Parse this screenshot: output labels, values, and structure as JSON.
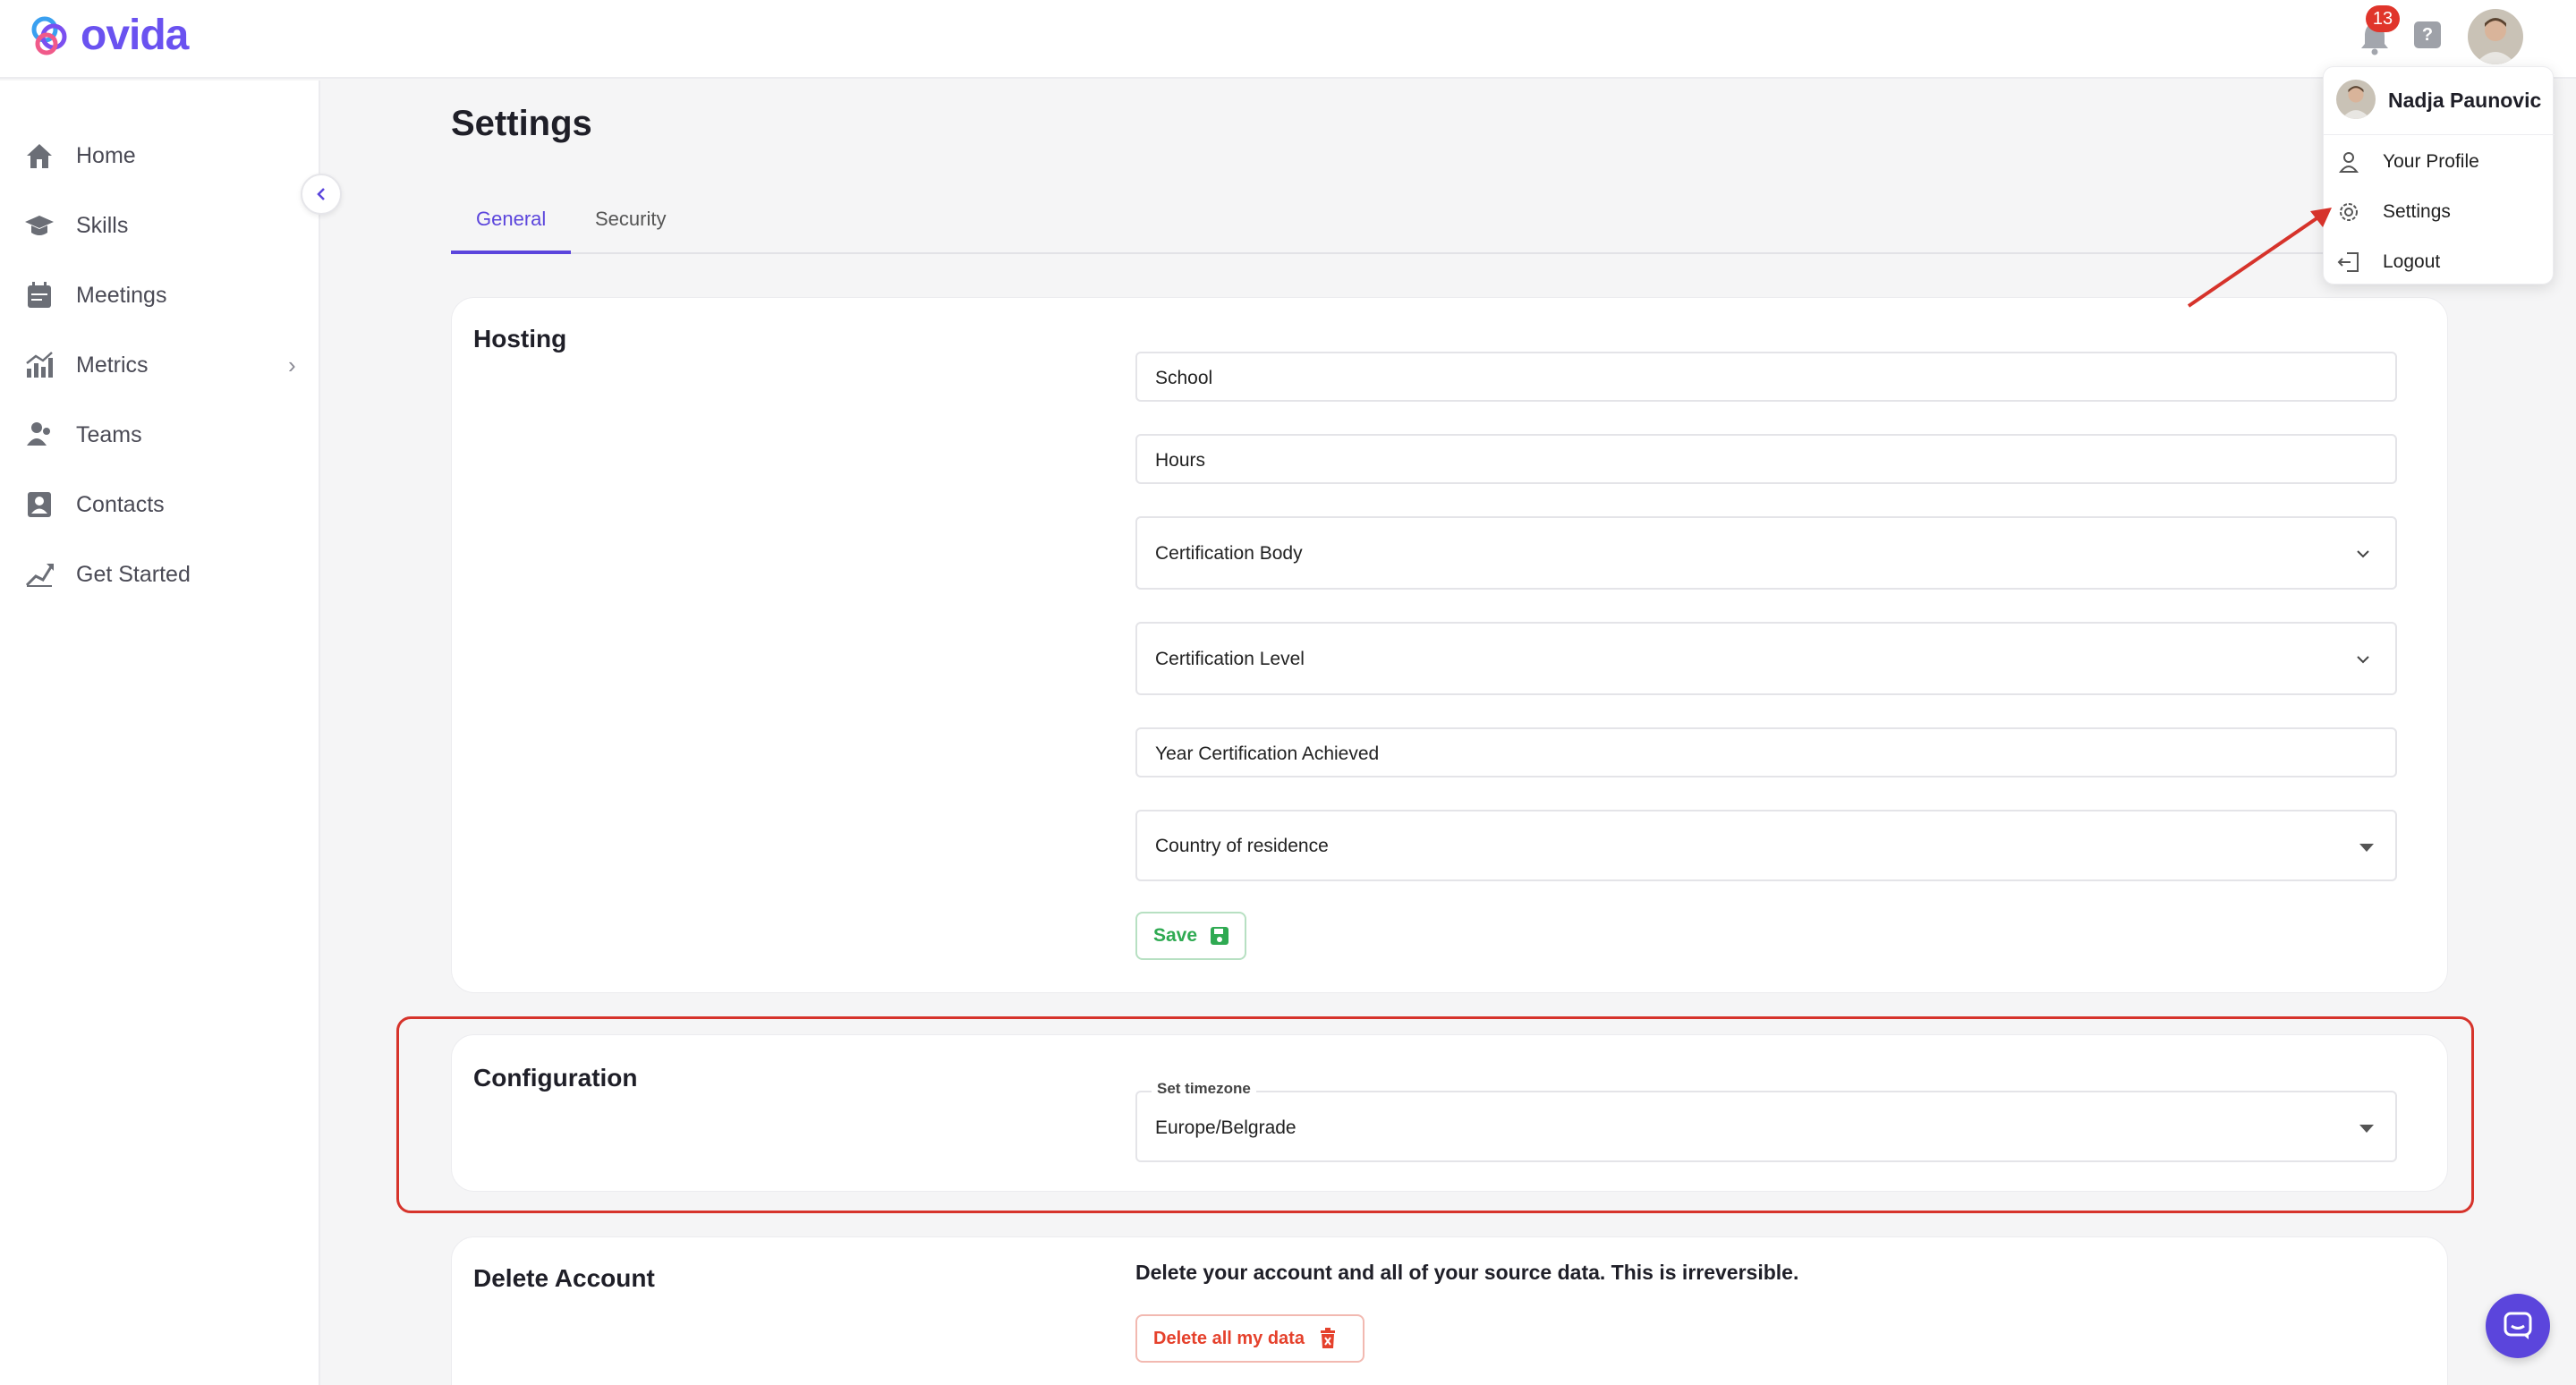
{
  "app": {
    "name": "ovida",
    "brand_color": "#6a52f0",
    "notification_count": "13",
    "help_label": "?"
  },
  "sidebar": {
    "items": [
      {
        "label": "Home",
        "icon": "home-icon"
      },
      {
        "label": "Skills",
        "icon": "graduation-cap-icon"
      },
      {
        "label": "Meetings",
        "icon": "calendar-icon"
      },
      {
        "label": "Metrics",
        "icon": "chart-icon",
        "has_submenu": true
      },
      {
        "label": "Teams",
        "icon": "users-icon"
      },
      {
        "label": "Contacts",
        "icon": "contact-card-icon"
      },
      {
        "label": "Get Started",
        "icon": "rocket-icon"
      }
    ]
  },
  "page": {
    "title": "Settings",
    "tabs": [
      {
        "label": "General",
        "active": true
      },
      {
        "label": "Security",
        "active": false
      }
    ]
  },
  "hosting": {
    "title": "Hosting",
    "school": "School",
    "hours": "Hours",
    "certification_body": "Certification Body",
    "certification_level": "Certification Level",
    "year_certification": "Year Certification Achieved",
    "country": "Country of residence",
    "save_label": "Save"
  },
  "configuration": {
    "title": "Configuration",
    "timezone_label": "Set timezone",
    "timezone_value": "Europe/Belgrade"
  },
  "delete_account": {
    "title": "Delete Account",
    "description": "Delete your account and all of your source data. This is irreversible.",
    "button_label": "Delete all my data"
  },
  "user_menu": {
    "name": "Nadja Paunovic",
    "items": [
      {
        "label": "Your Profile",
        "icon": "user-icon"
      },
      {
        "label": "Settings",
        "icon": "gear-icon"
      },
      {
        "label": "Logout",
        "icon": "logout-icon"
      }
    ]
  },
  "colors": {
    "accent": "#5b45dc",
    "highlight": "#d6332b",
    "save_green": "#2faa52",
    "delete_red": "#e5412c"
  }
}
